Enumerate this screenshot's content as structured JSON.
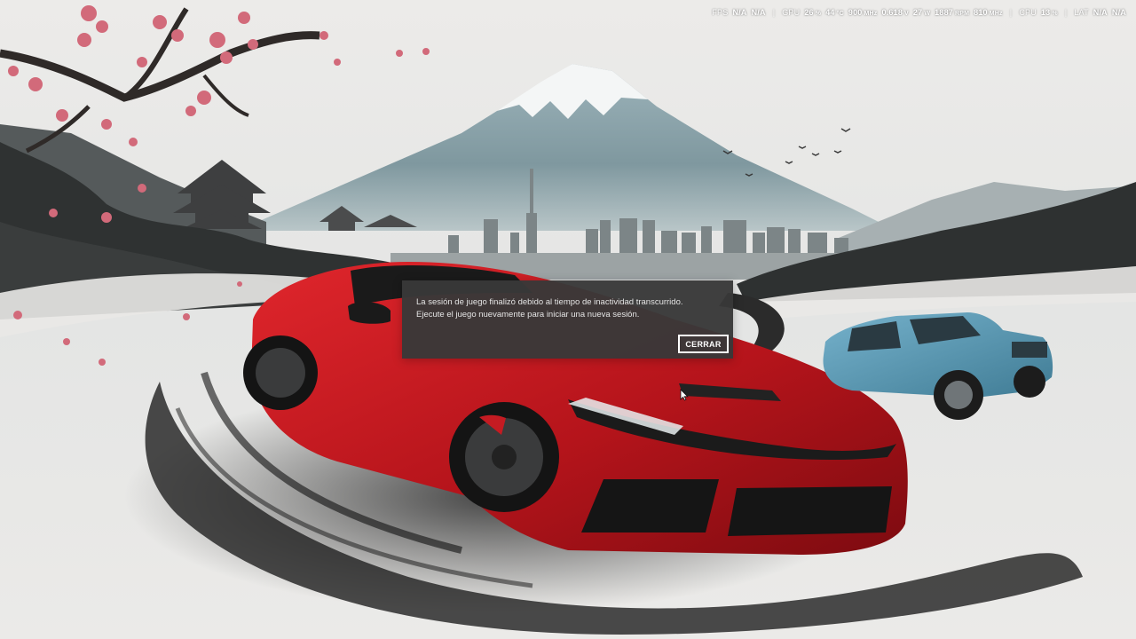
{
  "hud": {
    "fps_label": "FPS",
    "fps_value_1": "N/A",
    "fps_value_2": "N/A",
    "gpu_label": "GPU",
    "gpu_usage": "26",
    "gpu_usage_unit": "%",
    "gpu_temp": "44",
    "gpu_temp_unit": "°C",
    "gpu_clock": "900",
    "gpu_clock_unit": "MHz",
    "gpu_voltage": "0.618",
    "gpu_voltage_unit": "V",
    "gpu_power": "27",
    "gpu_power_unit": "W",
    "gpu_fan": "1887",
    "gpu_fan_unit": "RPM",
    "gpu_mem_clock": "810",
    "gpu_mem_clock_unit": "MHz",
    "cpu_label": "CPU",
    "cpu_usage": "13",
    "cpu_usage_unit": "%",
    "lat_label": "LAT",
    "lat_value_1": "N/A",
    "lat_value_2": "N/A",
    "separator": "|"
  },
  "dialog": {
    "line1": "La sesión de juego finalizó debido al tiempo de inactividad transcurrido.",
    "line2": "Ejecute el juego nuevamente para iniciar una nueva sesión.",
    "close_label": "CERRAR"
  }
}
